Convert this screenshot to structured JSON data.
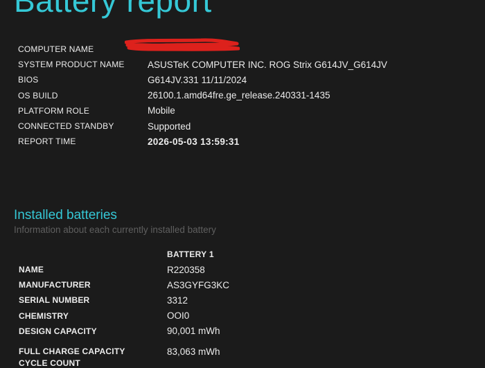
{
  "page": {
    "title": "Battery report"
  },
  "system_info": [
    {
      "label": "COMPUTER NAME",
      "value": ""
    },
    {
      "label": "SYSTEM PRODUCT NAME",
      "value": "ASUSTeK COMPUTER INC. ROG Strix G614JV_G614JV"
    },
    {
      "label": "BIOS",
      "value": "G614JV.331 11/11/2024"
    },
    {
      "label": "OS BUILD",
      "value": "26100.1.amd64fre.ge_release.240331-1435"
    },
    {
      "label": "PLATFORM ROLE",
      "value": "Mobile"
    },
    {
      "label": "CONNECTED STANDBY",
      "value": "Supported"
    },
    {
      "label": "REPORT TIME",
      "value": "2026-05-03  13:59:31"
    }
  ],
  "redaction_color": "#e8221c",
  "installed_batteries": {
    "title": "Installed batteries",
    "subtitle": "Information about each currently installed battery",
    "column_header": "BATTERY 1",
    "rows": [
      {
        "label": "NAME",
        "value": "R220358"
      },
      {
        "label": "MANUFACTURER",
        "value": "AS3GYFG3KC"
      },
      {
        "label": "SERIAL NUMBER",
        "value": "3312"
      },
      {
        "label": "CHEMISTRY",
        "value": "OOI0"
      },
      {
        "label": "DESIGN CAPACITY",
        "value": "90,001 mWh"
      },
      {
        "label": "FULL CHARGE CAPACITY",
        "value": "83,063 mWh"
      }
    ],
    "cutoff_label": "CYCLE COUNT"
  },
  "colors": {
    "background": "#1b1b1b",
    "accent": "#35c8d6",
    "text": "#ececec",
    "muted": "#5f5f5f"
  }
}
